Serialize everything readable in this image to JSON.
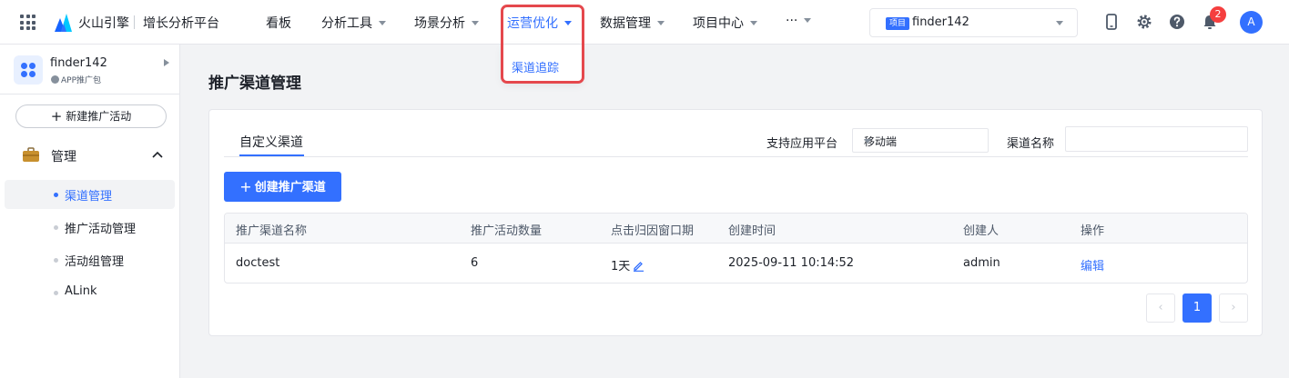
{
  "header": {
    "brand": "火山引擎",
    "platform": "增长分析平台",
    "nav": [
      {
        "label": "看板",
        "has_caret": false
      },
      {
        "label": "分析工具",
        "has_caret": true
      },
      {
        "label": "场景分析",
        "has_caret": true
      },
      {
        "label": "运营优化",
        "has_caret": true,
        "active": true
      },
      {
        "label": "数据管理",
        "has_caret": true
      },
      {
        "label": "项目中心",
        "has_caret": true
      },
      {
        "label": "···",
        "has_caret": true
      }
    ],
    "dropdown_item": "渠道追踪",
    "project_badge": "项目",
    "project_name": "finder142",
    "notification_count": "2",
    "avatar_initial": "A",
    "icons": [
      "mobile-icon",
      "gear-icon",
      "help-icon",
      "bell-icon"
    ],
    "accent_color": "#3370ff",
    "highlight_color": "#e5484d"
  },
  "sidebar": {
    "app_name": "finder142",
    "app_type": "APP推广包",
    "new_activity_label": "新建推广活动",
    "section_label": "管理",
    "items": [
      {
        "label": "渠道管理",
        "active": true
      },
      {
        "label": "推广活动管理",
        "active": false
      },
      {
        "label": "活动组管理",
        "active": false
      },
      {
        "label": "ALink",
        "active": false
      }
    ]
  },
  "main": {
    "title": "推广渠道管理",
    "tab_label": "自定义渠道",
    "platform_filter_label": "支持应用平台",
    "platform_value": "移动端",
    "channel_name_label": "渠道名称",
    "channel_name_value": "",
    "create_button": "创建推广渠道",
    "table": {
      "columns": [
        "推广渠道名称",
        "推广活动数量",
        "点击归因窗口期",
        "创建时间",
        "创建人",
        "操作"
      ],
      "rows": [
        {
          "name": "doctest",
          "activity_count": "6",
          "window": "1天",
          "created_at": "2025-09-11 10:14:52",
          "creator": "admin",
          "action": "编辑"
        }
      ]
    },
    "pagination": {
      "prev": "‹",
      "current": "1",
      "next": "›"
    }
  }
}
